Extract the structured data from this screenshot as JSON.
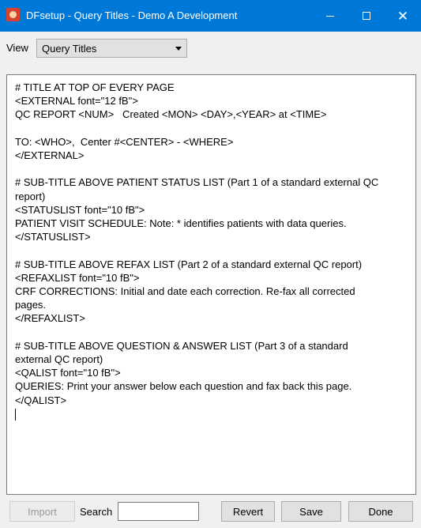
{
  "window": {
    "title": "DFsetup - Query Titles - Demo A Development",
    "icon": "dfsetup-app-icon",
    "controls": {
      "minimize": "minimize-icon",
      "maximize": "maximize-icon",
      "close": "close-icon"
    }
  },
  "view": {
    "label": "View",
    "selected": "Query Titles"
  },
  "editor": {
    "lines": [
      "# TITLE AT TOP OF EVERY PAGE",
      "<EXTERNAL font=\"12 fB\">",
      "QC REPORT <NUM>   Created <MON> <DAY>,<YEAR> at <TIME>",
      "",
      "TO: <WHO>,  Center #<CENTER> - <WHERE>",
      "</EXTERNAL>",
      "",
      "# SUB-TITLE ABOVE PATIENT STATUS LIST (Part 1 of a standard external QC",
      "report)",
      "<STATUSLIST font=\"10 fB\">",
      "PATIENT VISIT SCHEDULE: Note: * identifies patients with data queries.",
      "</STATUSLIST>",
      "",
      "# SUB-TITLE ABOVE REFAX LIST (Part 2 of a standard external QC report)",
      "<REFAXLIST font=\"10 fB\">",
      "CRF CORRECTIONS: Initial and date each correction. Re-fax all corrected",
      "pages.",
      "</REFAXLIST>",
      "",
      "# SUB-TITLE ABOVE QUESTION & ANSWER LIST (Part 3 of a standard",
      "external QC report)",
      "<QALIST font=\"10 fB\">",
      "QUERIES: Print your answer below each question and fax back this page.",
      "</QALIST>"
    ]
  },
  "bottom": {
    "import_label": "Import",
    "search_label": "Search",
    "search_value": "",
    "revert_label": "Revert",
    "save_label": "Save",
    "done_label": "Done"
  }
}
